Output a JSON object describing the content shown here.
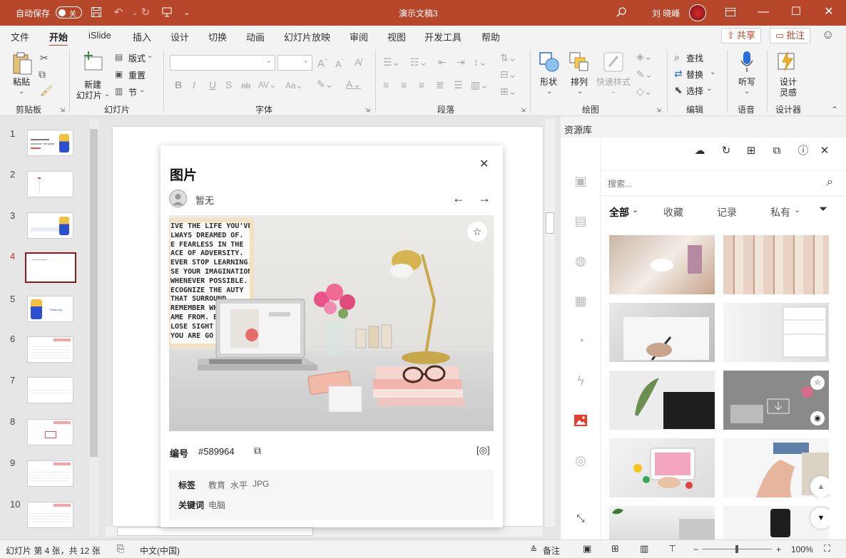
{
  "titlebar": {
    "autosave_label": "自动保存",
    "autosave_state": "关",
    "doc_title": "演示文稿3",
    "user_name": "刘 晓峰"
  },
  "ribbon_tabs": [
    "文件",
    "开始",
    "iSlide",
    "插入",
    "设计",
    "切换",
    "动画",
    "幻灯片放映",
    "审阅",
    "视图",
    "开发工具",
    "帮助"
  ],
  "active_tab": "开始",
  "share_label": "共享",
  "comment_label": "批注",
  "ribbon": {
    "paste": "粘贴",
    "group_clipboard": "剪贴板",
    "new_slide_line1": "新建",
    "new_slide_line2": "幻灯片",
    "layout": "版式",
    "reset": "重置",
    "section": "节",
    "group_slides": "幻灯片",
    "group_font": "字体",
    "group_paragraph": "段落",
    "shape": "形状",
    "arrange": "排列",
    "quick_style": "快速样式",
    "group_drawing": "绘图",
    "find": "查找",
    "replace": "替换",
    "select": "选择",
    "group_editing": "编辑",
    "dictate": "听写",
    "group_voice": "语音",
    "designer_line1": "设计",
    "designer_line2": "灵感",
    "group_designer": "设计器"
  },
  "slides": {
    "numbers": [
      "1",
      "2",
      "3",
      "4",
      "5",
      "6",
      "7",
      "8",
      "9",
      "10"
    ],
    "selected": "4",
    "thumb_texts": {
      "s1": "Question Template",
      "s5": "Thank you"
    }
  },
  "image_panel": {
    "title": "图片",
    "author": "暂无",
    "id_label": "编号",
    "id_value": "#589964",
    "tags_label": "标签",
    "tags": [
      "教育",
      "水平",
      "JPG"
    ],
    "keywords_label": "关键词",
    "keywords": [
      "电脑"
    ],
    "poster_lines": [
      "IVE THE LIFE YOU'VE",
      "LWAYS  DREAMED OF.",
      "E FEARLESS IN THE",
      "ACE OF ADVERSITY.",
      "EVER STOP LEARNING.",
      "SE YOUR IMAGINATION",
      "WHENEVER POSSIBLE.",
      "ECOGNIZE THE     AUTY",
      "THAT SURROUND",
      "REMEMBER WHI",
      "AME FROM. BE",
      "LOSE SIGHT OF",
      "YOU ARE GO"
    ]
  },
  "resource_panel": {
    "title": "资源库",
    "search_placeholder": "搜索...",
    "filters": [
      "全部",
      "收藏",
      "记录",
      "私有"
    ]
  },
  "statusbar": {
    "slide_info": "幻灯片 第 4 张，共 12 张",
    "language": "中文(中国)",
    "notes": "备注",
    "zoom": "100%"
  },
  "colors": {
    "accent": "#b7472a",
    "selected_slide": "#8b1a1a",
    "resource_active_icon": "#e63c2e"
  }
}
